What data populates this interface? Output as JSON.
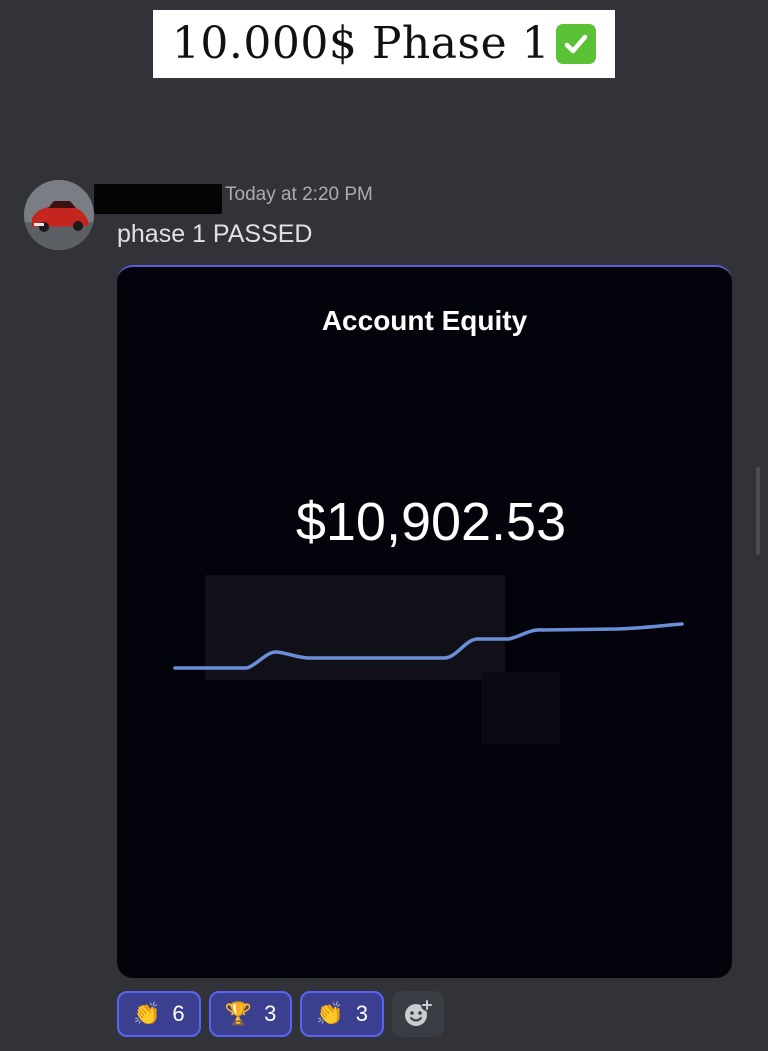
{
  "overlay": {
    "caption": "10.000$ Phase 1",
    "caption_icon": "green-check-box-icon"
  },
  "message": {
    "avatar_icon": "red-car-avatar",
    "username": "",
    "timestamp": "Today at 2:20 PM",
    "text": "phase 1 PASSED"
  },
  "embed": {
    "title": "Account Equity",
    "equity_value": "$10,902.53",
    "line_color": "#6b8fd6",
    "background": "#03030b",
    "accent_border": "#5b5bd6"
  },
  "reactions": [
    {
      "emoji": "👏",
      "icon": "clapping-hands-icon",
      "count": "6"
    },
    {
      "emoji": "🏆",
      "icon": "trophy-icon",
      "count": "3"
    },
    {
      "emoji": "👏",
      "icon": "clapping-hands-icon",
      "count": "3"
    }
  ],
  "add_reaction_icon": "add-reaction-icon",
  "colors": {
    "app_background": "#313338",
    "reaction_border": "#5865f2",
    "reaction_background": "#3b3f8f"
  }
}
